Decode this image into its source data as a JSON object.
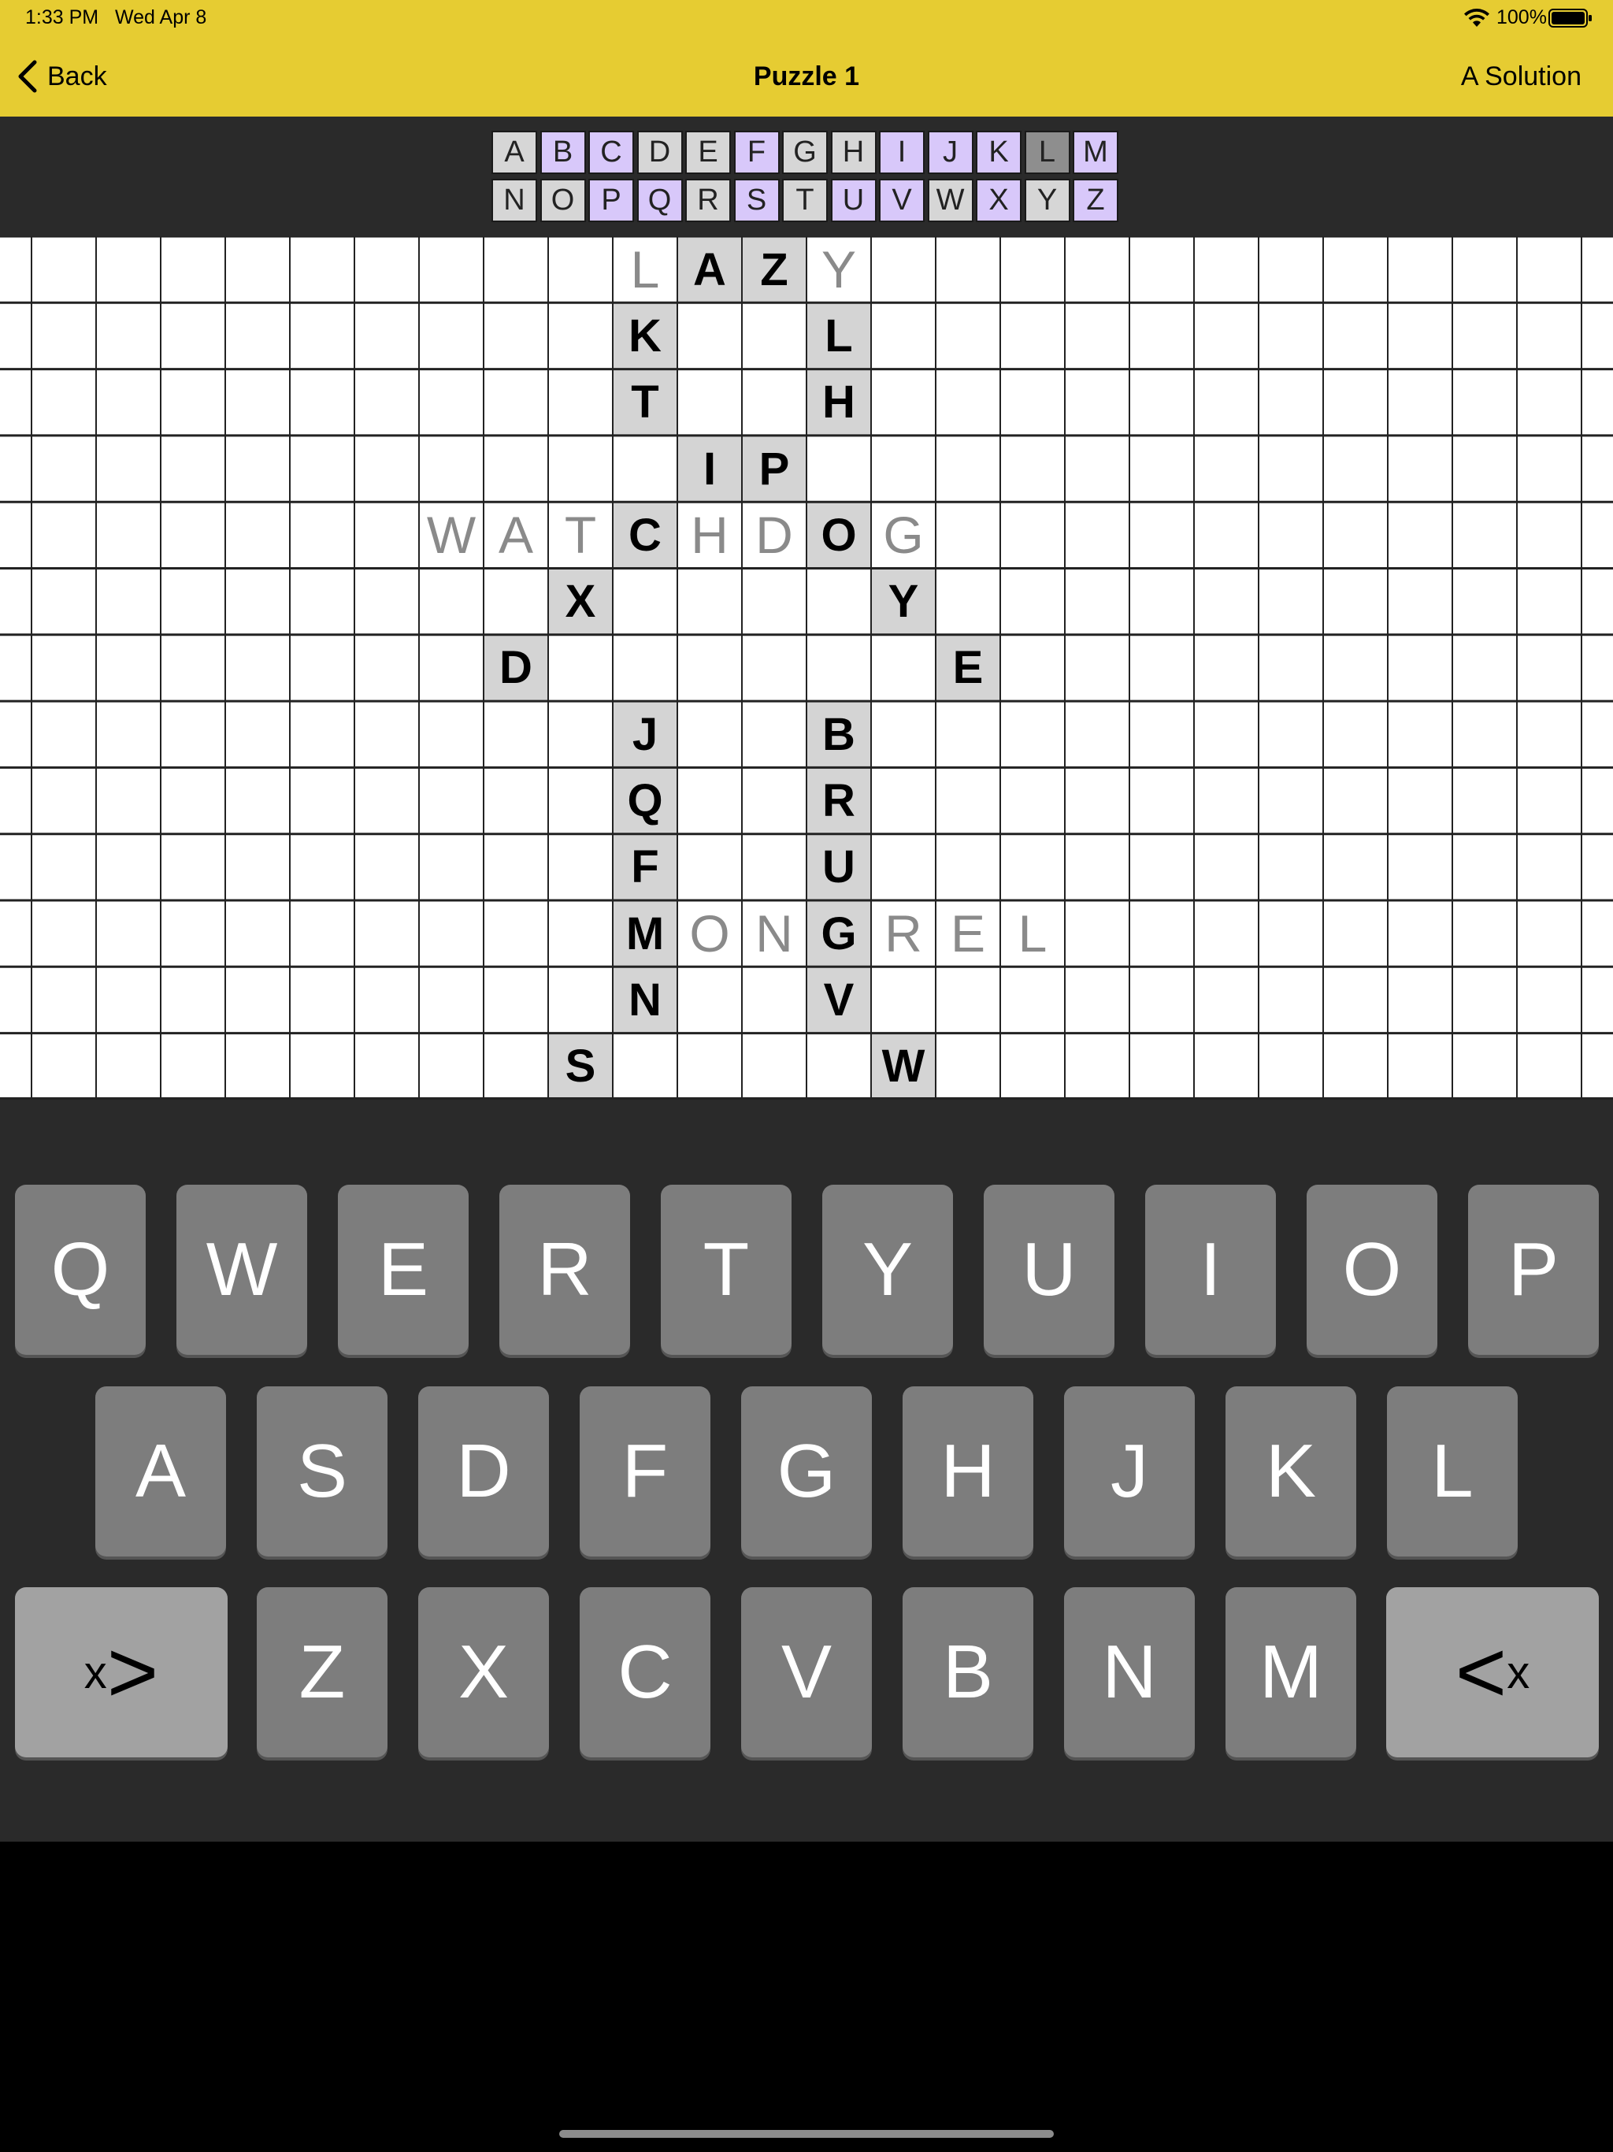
{
  "status": {
    "time": "1:33 PM",
    "date": "Wed Apr 8",
    "battery": "100%"
  },
  "nav": {
    "back_label": "Back",
    "title": "Puzzle 1",
    "solution_label": "A Solution"
  },
  "tracker_rows": [
    [
      {
        "l": "A",
        "s": "u"
      },
      {
        "l": "B",
        "s": "p"
      },
      {
        "l": "C",
        "s": "p"
      },
      {
        "l": "D",
        "s": "u"
      },
      {
        "l": "E",
        "s": "u"
      },
      {
        "l": "F",
        "s": "p"
      },
      {
        "l": "G",
        "s": "u"
      },
      {
        "l": "H",
        "s": "u"
      },
      {
        "l": "I",
        "s": "p"
      },
      {
        "l": "J",
        "s": "p"
      },
      {
        "l": "K",
        "s": "p"
      },
      {
        "l": "L",
        "s": "d"
      },
      {
        "l": "M",
        "s": "p"
      }
    ],
    [
      {
        "l": "N",
        "s": "u"
      },
      {
        "l": "O",
        "s": "u"
      },
      {
        "l": "P",
        "s": "p"
      },
      {
        "l": "Q",
        "s": "p"
      },
      {
        "l": "R",
        "s": "u"
      },
      {
        "l": "S",
        "s": "p"
      },
      {
        "l": "T",
        "s": "u"
      },
      {
        "l": "U",
        "s": "p"
      },
      {
        "l": "V",
        "s": "p"
      },
      {
        "l": "W",
        "s": "u"
      },
      {
        "l": "X",
        "s": "p"
      },
      {
        "l": "Y",
        "s": "u"
      },
      {
        "l": "Z",
        "s": "p"
      }
    ]
  ],
  "tracker_colors": {
    "u": "#D6D6D6",
    "p": "#D8C8FA",
    "d": "#8E8E8E"
  },
  "grid_cells": [
    {
      "r": 0,
      "c": 10,
      "l": "L",
      "t": "hint"
    },
    {
      "r": 0,
      "c": 11,
      "l": "A",
      "t": "tile"
    },
    {
      "r": 0,
      "c": 12,
      "l": "Z",
      "t": "tile"
    },
    {
      "r": 0,
      "c": 13,
      "l": "Y",
      "t": "hint"
    },
    {
      "r": 1,
      "c": 10,
      "l": "K",
      "t": "tile"
    },
    {
      "r": 1,
      "c": 13,
      "l": "L",
      "t": "tile"
    },
    {
      "r": 2,
      "c": 10,
      "l": "T",
      "t": "tile"
    },
    {
      "r": 2,
      "c": 13,
      "l": "H",
      "t": "tile"
    },
    {
      "r": 3,
      "c": 11,
      "l": "I",
      "t": "tile"
    },
    {
      "r": 3,
      "c": 12,
      "l": "P",
      "t": "tile"
    },
    {
      "r": 4,
      "c": 7,
      "l": "W",
      "t": "hint"
    },
    {
      "r": 4,
      "c": 8,
      "l": "A",
      "t": "hint"
    },
    {
      "r": 4,
      "c": 9,
      "l": "T",
      "t": "hint"
    },
    {
      "r": 4,
      "c": 10,
      "l": "C",
      "t": "tile"
    },
    {
      "r": 4,
      "c": 11,
      "l": "H",
      "t": "hint"
    },
    {
      "r": 4,
      "c": 12,
      "l": "D",
      "t": "hint"
    },
    {
      "r": 4,
      "c": 13,
      "l": "O",
      "t": "tile"
    },
    {
      "r": 4,
      "c": 14,
      "l": "G",
      "t": "hint"
    },
    {
      "r": 5,
      "c": 9,
      "l": "X",
      "t": "tile"
    },
    {
      "r": 5,
      "c": 14,
      "l": "Y",
      "t": "tile"
    },
    {
      "r": 6,
      "c": 8,
      "l": "D",
      "t": "tile"
    },
    {
      "r": 6,
      "c": 15,
      "l": "E",
      "t": "tile"
    },
    {
      "r": 7,
      "c": 10,
      "l": "J",
      "t": "tile"
    },
    {
      "r": 7,
      "c": 13,
      "l": "B",
      "t": "tile"
    },
    {
      "r": 8,
      "c": 10,
      "l": "Q",
      "t": "tile"
    },
    {
      "r": 8,
      "c": 13,
      "l": "R",
      "t": "tile"
    },
    {
      "r": 9,
      "c": 10,
      "l": "F",
      "t": "tile"
    },
    {
      "r": 9,
      "c": 13,
      "l": "U",
      "t": "tile"
    },
    {
      "r": 10,
      "c": 10,
      "l": "M",
      "t": "tile"
    },
    {
      "r": 10,
      "c": 11,
      "l": "O",
      "t": "hint"
    },
    {
      "r": 10,
      "c": 12,
      "l": "N",
      "t": "hint"
    },
    {
      "r": 10,
      "c": 13,
      "l": "G",
      "t": "tile"
    },
    {
      "r": 10,
      "c": 14,
      "l": "R",
      "t": "hint"
    },
    {
      "r": 10,
      "c": 15,
      "l": "E",
      "t": "hint"
    },
    {
      "r": 10,
      "c": 16,
      "l": "L",
      "t": "hint"
    },
    {
      "r": 11,
      "c": 10,
      "l": "N",
      "t": "tile"
    },
    {
      "r": 11,
      "c": 13,
      "l": "V",
      "t": "tile"
    },
    {
      "r": 12,
      "c": 9,
      "l": "S",
      "t": "tile"
    },
    {
      "r": 12,
      "c": 14,
      "l": "W",
      "t": "tile"
    }
  ],
  "grid_colors": {
    "tile": "#D4D4D4",
    "hint": "#FFFFFF",
    "line": "#222222"
  },
  "keyboard": {
    "row1": [
      "Q",
      "W",
      "E",
      "R",
      "T",
      "Y",
      "U",
      "I",
      "O",
      "P"
    ],
    "row2": [
      "A",
      "S",
      "D",
      "F",
      "G",
      "H",
      "J",
      "K",
      "L"
    ],
    "row3": [
      "Z",
      "X",
      "C",
      "V",
      "B",
      "N",
      "M"
    ],
    "left_key": {
      "small": "x",
      "big": ">"
    },
    "right_key": {
      "big": "<",
      "small": "x"
    }
  }
}
